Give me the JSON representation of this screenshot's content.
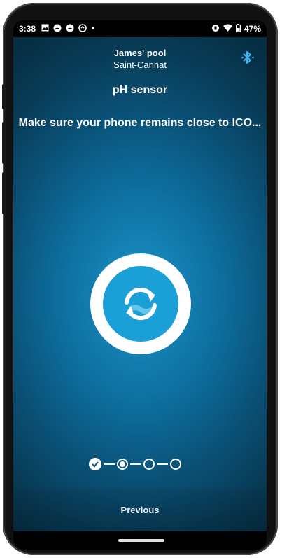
{
  "status_bar": {
    "time": "3:38",
    "battery": "47%",
    "left_icons": [
      "image-icon",
      "cloud-icon",
      "cloud-icon",
      "sync-notification-icon",
      "dot-icon"
    ],
    "right_icons": [
      "vibrate-icon",
      "wifi-icon",
      "battery-icon"
    ]
  },
  "header": {
    "pool_name": "James' pool",
    "location": "Saint-Cannat",
    "bluetooth_icon": "bluetooth-icon"
  },
  "sensor": {
    "title": "pH sensor"
  },
  "message": "Make sure your phone remains close to ICO...",
  "sync_icon": "sync-icon",
  "stepper": {
    "total": 4,
    "completed": 1,
    "current": 2
  },
  "footer": {
    "previous_label": "Previous"
  },
  "colors": {
    "background": "#0d6e9e",
    "accent": "#1a9fd6",
    "bluetooth": "#3ab4f2"
  }
}
